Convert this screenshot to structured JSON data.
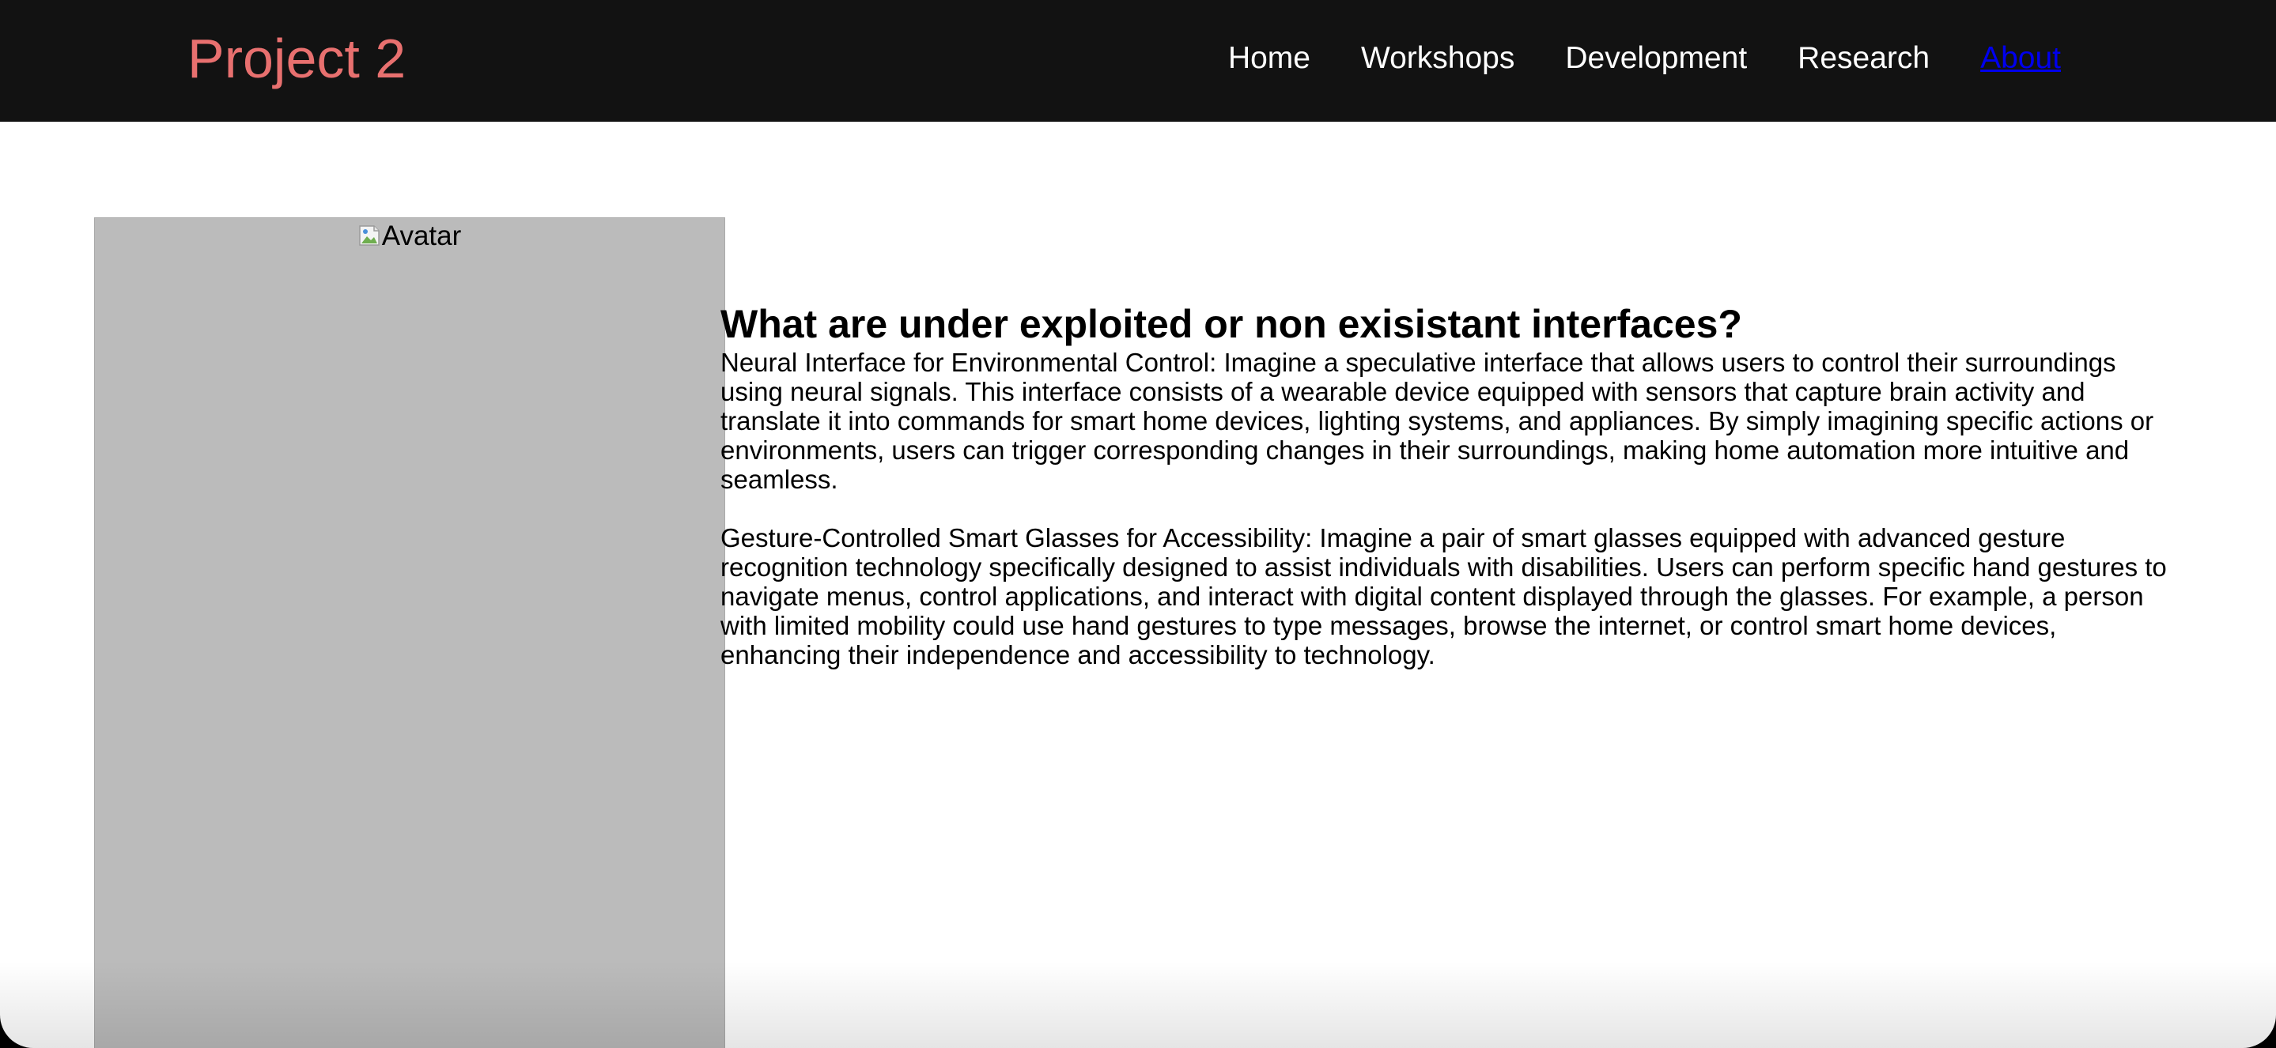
{
  "navbar": {
    "brand": "Project 2",
    "links": [
      {
        "label": "Home"
      },
      {
        "label": "Workshops"
      },
      {
        "label": "Development"
      },
      {
        "label": "Research"
      },
      {
        "label": "About"
      }
    ],
    "colors": {
      "background": "#121212",
      "brand": "#e8706f",
      "link": "#ffffff",
      "active_link": "#0000ee"
    }
  },
  "avatar": {
    "alt_text": "Avatar",
    "icon": "broken-image-icon",
    "placeholder_color": "#bbbbbb"
  },
  "main": {
    "heading": "What are under exploited or non exisistant interfaces?",
    "paragraphs": [
      "Neural Interface for Environmental Control: Imagine a speculative interface that allows users to control their surroundings using neural signals. This interface consists of a wearable device equipped with sensors that capture brain activity and translate it into commands for smart home devices, lighting systems, and appliances. By simply imagining specific actions or environments, users can trigger corresponding changes in their surroundings, making home automation more intuitive and seamless.",
      "Gesture-Controlled Smart Glasses for Accessibility: Imagine a pair of smart glasses equipped with advanced gesture recognition technology specifically designed to assist individuals with disabilities. Users can perform specific hand gestures to navigate menus, control applications, and interact with digital content displayed through the glasses. For example, a person with limited mobility could use hand gestures to type messages, browse the internet, or control smart home devices, enhancing their independence and accessibility to technology."
    ]
  }
}
